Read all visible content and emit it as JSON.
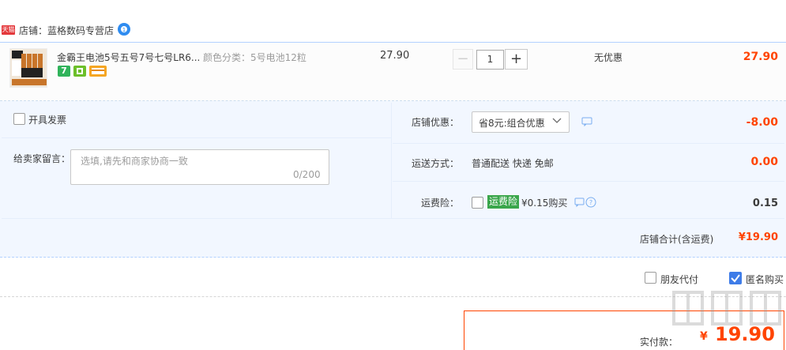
{
  "shop": {
    "badge": "天猫",
    "label": "店铺：蓝格数码专营店"
  },
  "item": {
    "title": "金霸王电池5号五号7号七号LR6...",
    "spec": "颜色分类：5号电池12粒",
    "unit_price": "27.90",
    "quantity": "1",
    "minus": "−",
    "plus": "+",
    "discount": "无优惠",
    "subtotal": "27.90",
    "badge_seven": "7"
  },
  "invoice": {
    "label": "开具发票"
  },
  "memo": {
    "label": "给卖家留言：",
    "placeholder": "选填,请先和商家协商一致",
    "count": "0/200"
  },
  "promo": {
    "label": "店铺优惠：",
    "selected": "省8元:组合优惠",
    "value": "-8.00"
  },
  "shipping": {
    "label": "运送方式：",
    "value": "普通配送 快递 免邮",
    "fee": "0.00"
  },
  "insurance": {
    "label": "运费险：",
    "badge": "运费险",
    "price": "¥0.15购买",
    "fee": "0.15"
  },
  "shop_total": {
    "label": "店铺合计(含运费)",
    "value": "¥19.90"
  },
  "options": {
    "friend_pay": "朋友代付",
    "anonymous": "匿名购买"
  },
  "pay": {
    "label": "实付款：",
    "symbol": "¥",
    "value": "19.90"
  },
  "colors": {
    "price_red": "#ff4400",
    "panel_bg": "#f2f7ff",
    "checkbox_blue": "#3e7ce8",
    "insurance_green": "#3aa64b"
  }
}
